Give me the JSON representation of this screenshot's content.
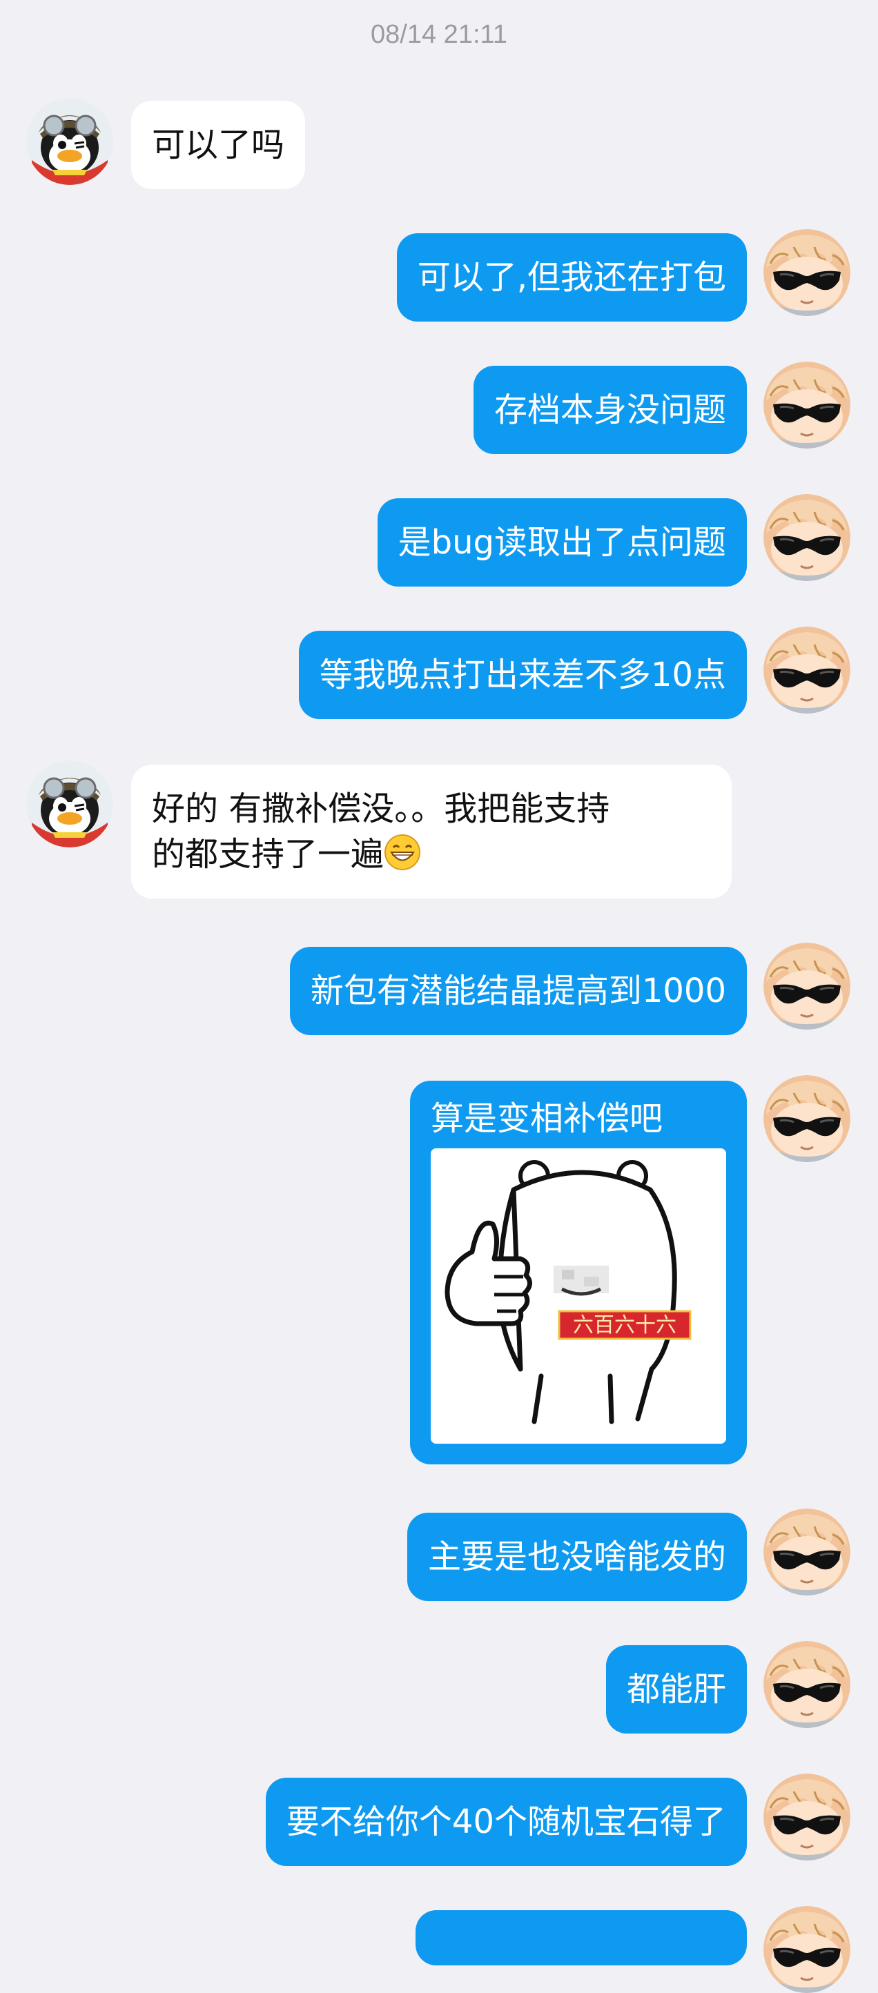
{
  "timestamp": "08/14 21:11",
  "colors": {
    "background": "#f1f1f5",
    "outgoing_bubble": "#0f9af2",
    "incoming_bubble": "#ffffff"
  },
  "messages": [
    {
      "side": "in",
      "text": "可以了吗",
      "avatar": "penguin-pilot-avatar"
    },
    {
      "side": "out",
      "text": "可以了,但我还在打包",
      "avatar": "sunglasses-anime-avatar"
    },
    {
      "side": "out",
      "text": "存档本身没问题",
      "avatar": "sunglasses-anime-avatar"
    },
    {
      "side": "out",
      "text": "是bug读取出了点问题",
      "avatar": "sunglasses-anime-avatar"
    },
    {
      "side": "out",
      "text": "等我晚点打出来差不多10点",
      "avatar": "sunglasses-anime-avatar"
    },
    {
      "side": "in",
      "text_line1": "好的  有撒补偿没。。我把能支持",
      "text_line2": "的都支持了一遍",
      "emoji": "grinning-face-emoji",
      "avatar": "penguin-pilot-avatar"
    },
    {
      "side": "out",
      "text": "新包有潜能结晶提高到1000",
      "avatar": "sunglasses-anime-avatar"
    },
    {
      "side": "out",
      "text": "算是变相补偿吧",
      "sticker": "thumbs-up-bear-sticker",
      "sticker_text": "六百六十六",
      "avatar": "sunglasses-anime-avatar"
    },
    {
      "side": "out",
      "text": "主要是也没啥能发的",
      "avatar": "sunglasses-anime-avatar"
    },
    {
      "side": "out",
      "text": "都能肝",
      "avatar": "sunglasses-anime-avatar"
    },
    {
      "side": "out",
      "text": "要不给你个40个随机宝石得了",
      "avatar": "sunglasses-anime-avatar"
    }
  ]
}
